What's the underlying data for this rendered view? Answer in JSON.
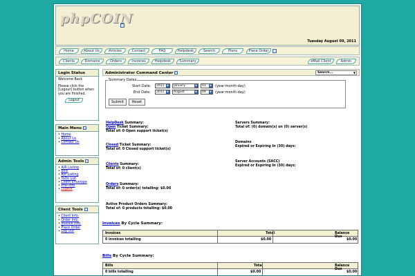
{
  "header": {
    "logo_text": "phpCOIN",
    "date": "Tuesday August 09, 2011"
  },
  "nav_top": [
    "Home",
    "About Us",
    "Articles",
    "Contact",
    "FAQ",
    "Helpdesk",
    "Search",
    "Plans",
    "Place Order"
  ],
  "nav_admin": [
    "Clients",
    "Domains",
    "Orders",
    "Invoices",
    "Helpdesk",
    "Summary"
  ],
  "nav_admin_right": [
    "eMail Client",
    "Admin"
  ],
  "login": {
    "title": "Login Status",
    "welcome": "Welcome Back",
    "msg": "Please click the [Logout] button when you are finished.",
    "button": "Logout"
  },
  "main_menu": {
    "title": "Main Menu",
    "items": [
      "Home",
      "About Us",
      "Contact Us"
    ]
  },
  "admin_tools": {
    "title": "Admin Tools",
    "items": [
      "A/R Listing",
      "Bills",
      "A/P Listing",
      "ToDo List",
      "Client Envelope",
      "PHP-Info",
      "Logout"
    ]
  },
  "client_tools": {
    "title": "Client Tools",
    "items": [
      "Client Info.",
      "Order Info.",
      "Invoice Info.",
      "Place Order",
      "Log Out"
    ]
  },
  "main": {
    "title": "Administrator Command Center",
    "search_select": "Search...",
    "summary_dates": "Summary Dates",
    "start_label": "Start Date:",
    "end_label": "End Date:",
    "start": {
      "year": "2011",
      "month": "January",
      "day": "01"
    },
    "end": {
      "year": "2011",
      "month": "August",
      "day": "09"
    },
    "format_hint": "(year-month-day)",
    "submit": "Submit",
    "reset": "Reset"
  },
  "summaries_left": [
    {
      "link": "HelpDesk",
      "suffix": " Summary:",
      "line1_link": "Open",
      "line1_rest": " Ticket Summary:",
      "line2": "Total of: 0 Open support ticket(s)"
    },
    {
      "link": "Closed",
      "suffix": " Ticket Summary:",
      "line2": "Total of: 0 Closed support ticket(s)"
    },
    {
      "link": "Clients",
      "suffix": " Summary:",
      "line2": "Total of: 0 client(s)"
    },
    {
      "link": "Orders",
      "suffix": " Summary:",
      "line2": "Total of: 0 order(s) totalling:  $0.00"
    }
  ],
  "active_orders": {
    "title": "Active Product Orders Summary:",
    "line": "Total of: 0 products totalling:  $0.00"
  },
  "summaries_right": [
    {
      "title": "Servers Summary:",
      "line": "Total of: (0) domain(s) on (0) server(s)"
    },
    {
      "title": "Domains",
      "line": "Expired or Expiring In (30) days:"
    },
    {
      "title": "Server Accounts (SACC)",
      "line": "Expired or Expiring In (30) days:"
    }
  ],
  "invoices_summary": {
    "title_link": "Invoices",
    "title_rest": " By Cycle Summary:",
    "headers": [
      "Invoices",
      "Total",
      "Balance Due"
    ],
    "row": [
      "0 invoices totalling",
      "$0.00",
      "$0.00"
    ]
  },
  "bills_summary": {
    "title_link": "Bills",
    "title_rest": " By Cycle Summary:",
    "headers": [
      "Bills",
      "Total",
      "Balance Due"
    ],
    "row": [
      "0 bills totalling",
      "$0.00",
      "$0.00"
    ]
  }
}
